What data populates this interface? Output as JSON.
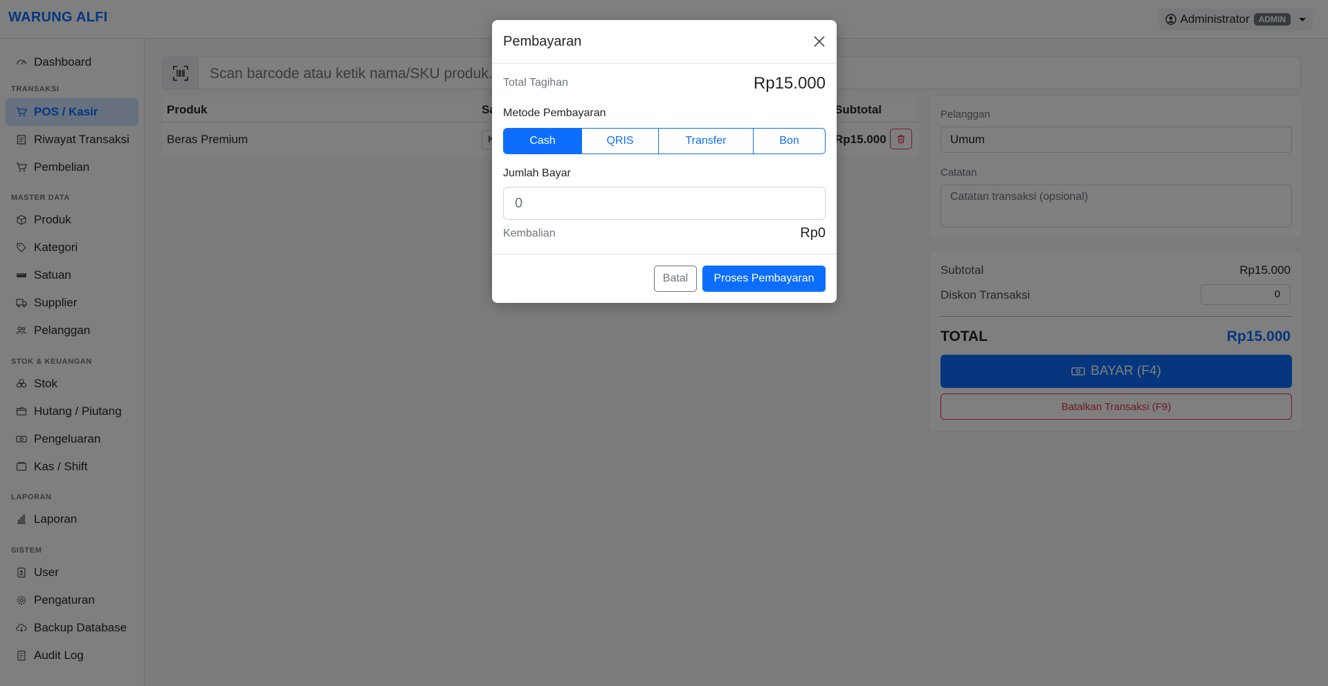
{
  "app": {
    "brand": "WARUNG ALFI"
  },
  "user": {
    "name": "Administrator",
    "role": "ADMIN"
  },
  "sidebar": {
    "dashboard": "Dashboard",
    "sections": {
      "transaksi": "TRANSAKSI",
      "master": "MASTER DATA",
      "stok": "STOK & KEUANGAN",
      "laporan": "LAPORAN",
      "sistem": "SISTEM"
    },
    "items": {
      "pos": "POS / Kasir",
      "riwayat": "Riwayat Transaksi",
      "pembelian": "Pembelian",
      "produk": "Produk",
      "kategori": "Kategori",
      "satuan": "Satuan",
      "supplier": "Supplier",
      "pelanggan": "Pelanggan",
      "stok": "Stok",
      "hutang": "Hutang / Piutang",
      "pengeluaran": "Pengeluaran",
      "kas": "Kas / Shift",
      "laporan": "Laporan",
      "user": "User",
      "pengaturan": "Pengaturan",
      "backup": "Backup Database",
      "audit": "Audit Log"
    }
  },
  "scan": {
    "placeholder": "Scan barcode atau ketik nama/SKU produk..."
  },
  "cart": {
    "headers": {
      "produk": "Produk",
      "satuan": "Sa",
      "subtotal": "Subtotal"
    },
    "rows": [
      {
        "produk": "Beras Premium",
        "satuan": "K",
        "subtotal": "Rp15.000"
      }
    ]
  },
  "customer": {
    "label": "Pelanggan",
    "value": "Umum",
    "notes_label": "Catatan",
    "notes_placeholder": "Catatan transaksi (opsional)"
  },
  "summary": {
    "subtotal_label": "Subtotal",
    "subtotal_value": "Rp15.000",
    "discount_label": "Diskon Transaksi",
    "discount_value": "0",
    "total_label": "TOTAL",
    "total_value": "Rp15.000",
    "pay_button": "BAYAR (F4)",
    "cancel_button": "Batalkan Transaksi (F9)"
  },
  "modal": {
    "title": "Pembayaran",
    "bill_label": "Total Tagihan",
    "bill_value": "Rp15.000",
    "method_label": "Metode Pembayaran",
    "methods": [
      "Cash",
      "QRIS",
      "Transfer",
      "Bon"
    ],
    "selected_method": "Cash",
    "amount_label": "Jumlah Bayar",
    "amount_value": "0",
    "change_label": "Kembalian",
    "change_value": "Rp0",
    "cancel_button": "Batal",
    "process_button": "Proses Pembayaran"
  },
  "colors": {
    "primary": "#0d6efd",
    "danger": "#dc3545",
    "muted": "#6c757d"
  }
}
